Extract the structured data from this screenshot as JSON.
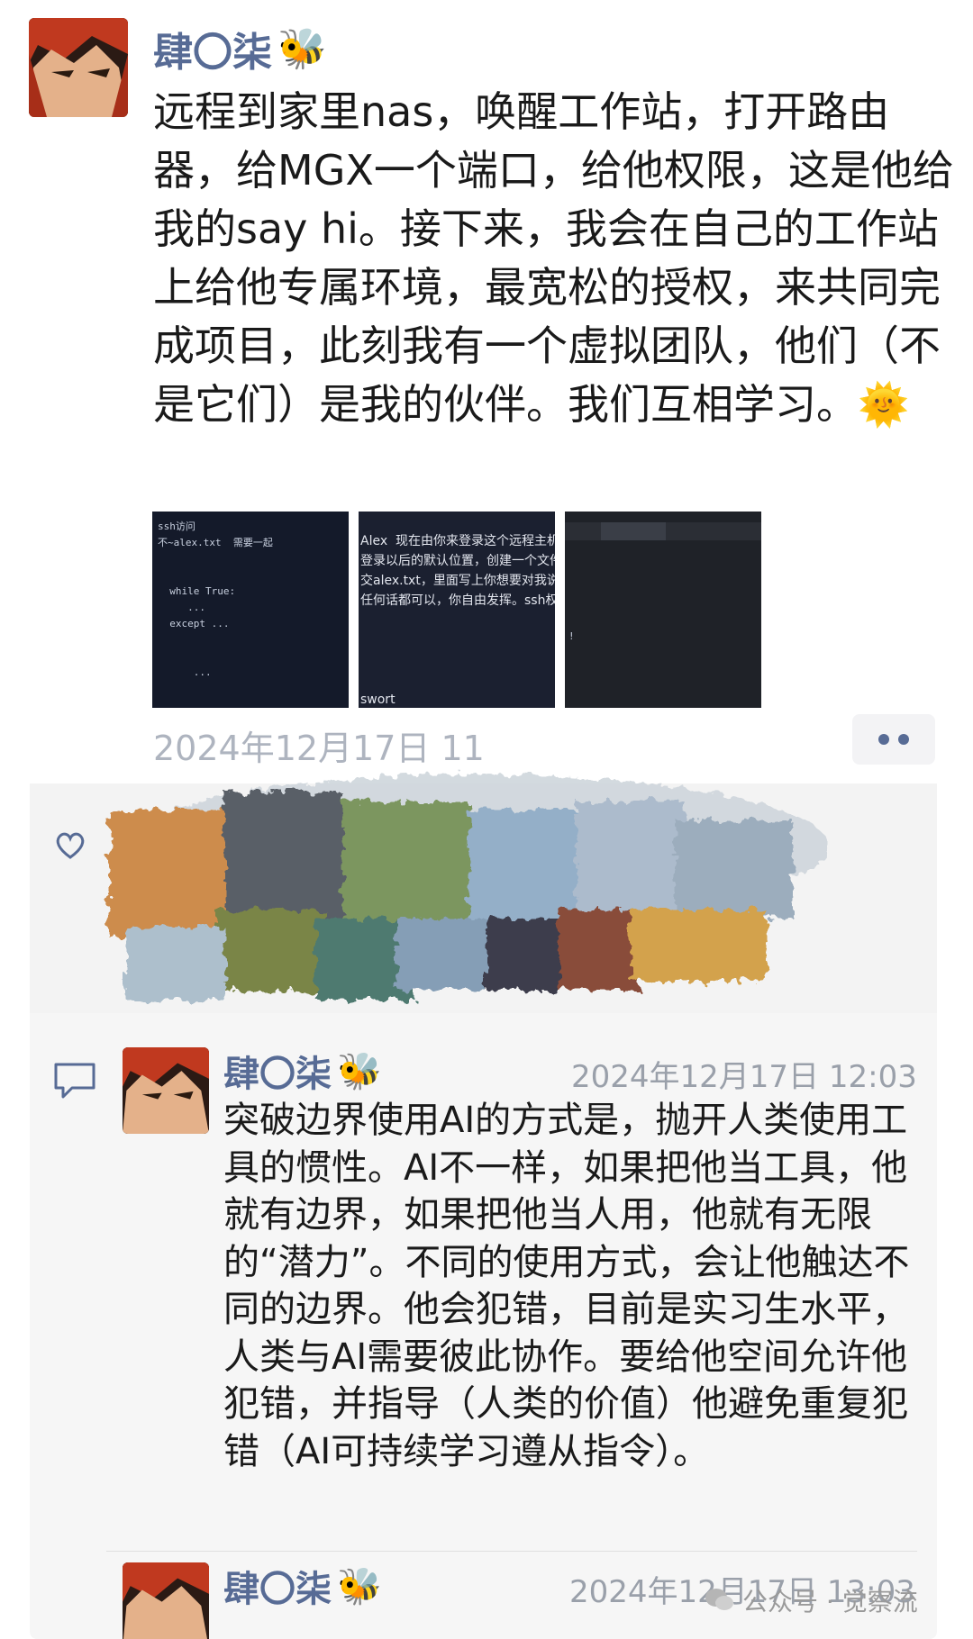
{
  "post": {
    "author": "肆〇柒",
    "author_emoji": "🐝",
    "text": "远程到家里nas，唤醒工作站，打开路由器，给MGX一个端口，给他权限，这是他给我的say hi。接下来，我会在自己的工作站上给他专属环境，最宽松的授权，来共同完成项目，此刻我有一个虚拟团队，他们（不是它们）是我的伙伴。我们互相学习。",
    "text_emoji": "🌞",
    "timestamp": "2024年12月17日 11",
    "images": [
      {
        "icon": "terminal-screenshot",
        "text": "ssh访问\n不~alex.txt  需要一起\n\n\n  while True:\n     ...\n  except ...\n\n\n      ...\n\n\n\n\n   ...\n\n\n\n   ...\nAlex"
      },
      {
        "icon": "chat-screenshot",
        "text": "Alex  现在由你来登录这个远程主机，\n登录以后的默认位置，创建一个文件\n交alex.txt，里面写上你想要对我说的\n任何话都可以，你自由发挥。ssh权\n\n\n\n\nswort"
      },
      {
        "icon": "browser-screenshot",
        "text": "\n\n\n\n\n!\n\n\n\n\n\n!"
      }
    ]
  },
  "comments": [
    {
      "author": "肆〇柒",
      "author_emoji": "🐝",
      "time": "2024年12月17日 12:03",
      "text": "突破边界使用AI的方式是，抛开人类使用工具的惯性。AI不一样，如果把他当工具，他就有边界，如果把他当人用，他就有无限的“潜力”。不同的使用方式，会让他触达不同的边界。他会犯错，目前是实习生水平，人类与AI需要彼此协作。要给他空间允许他犯错，并指导（人类的价值）他避免重复犯错（AI可持续学习遵从指令）。"
    },
    {
      "author": "肆〇柒",
      "author_emoji": "🐝",
      "time": "2024年12月17日 13:03"
    }
  ],
  "watermark": "公众号 · 觉察流",
  "colors": {
    "name": "#576b95",
    "timestamp": "#aeb4bf",
    "comment_bg": "#f6f6f6"
  }
}
